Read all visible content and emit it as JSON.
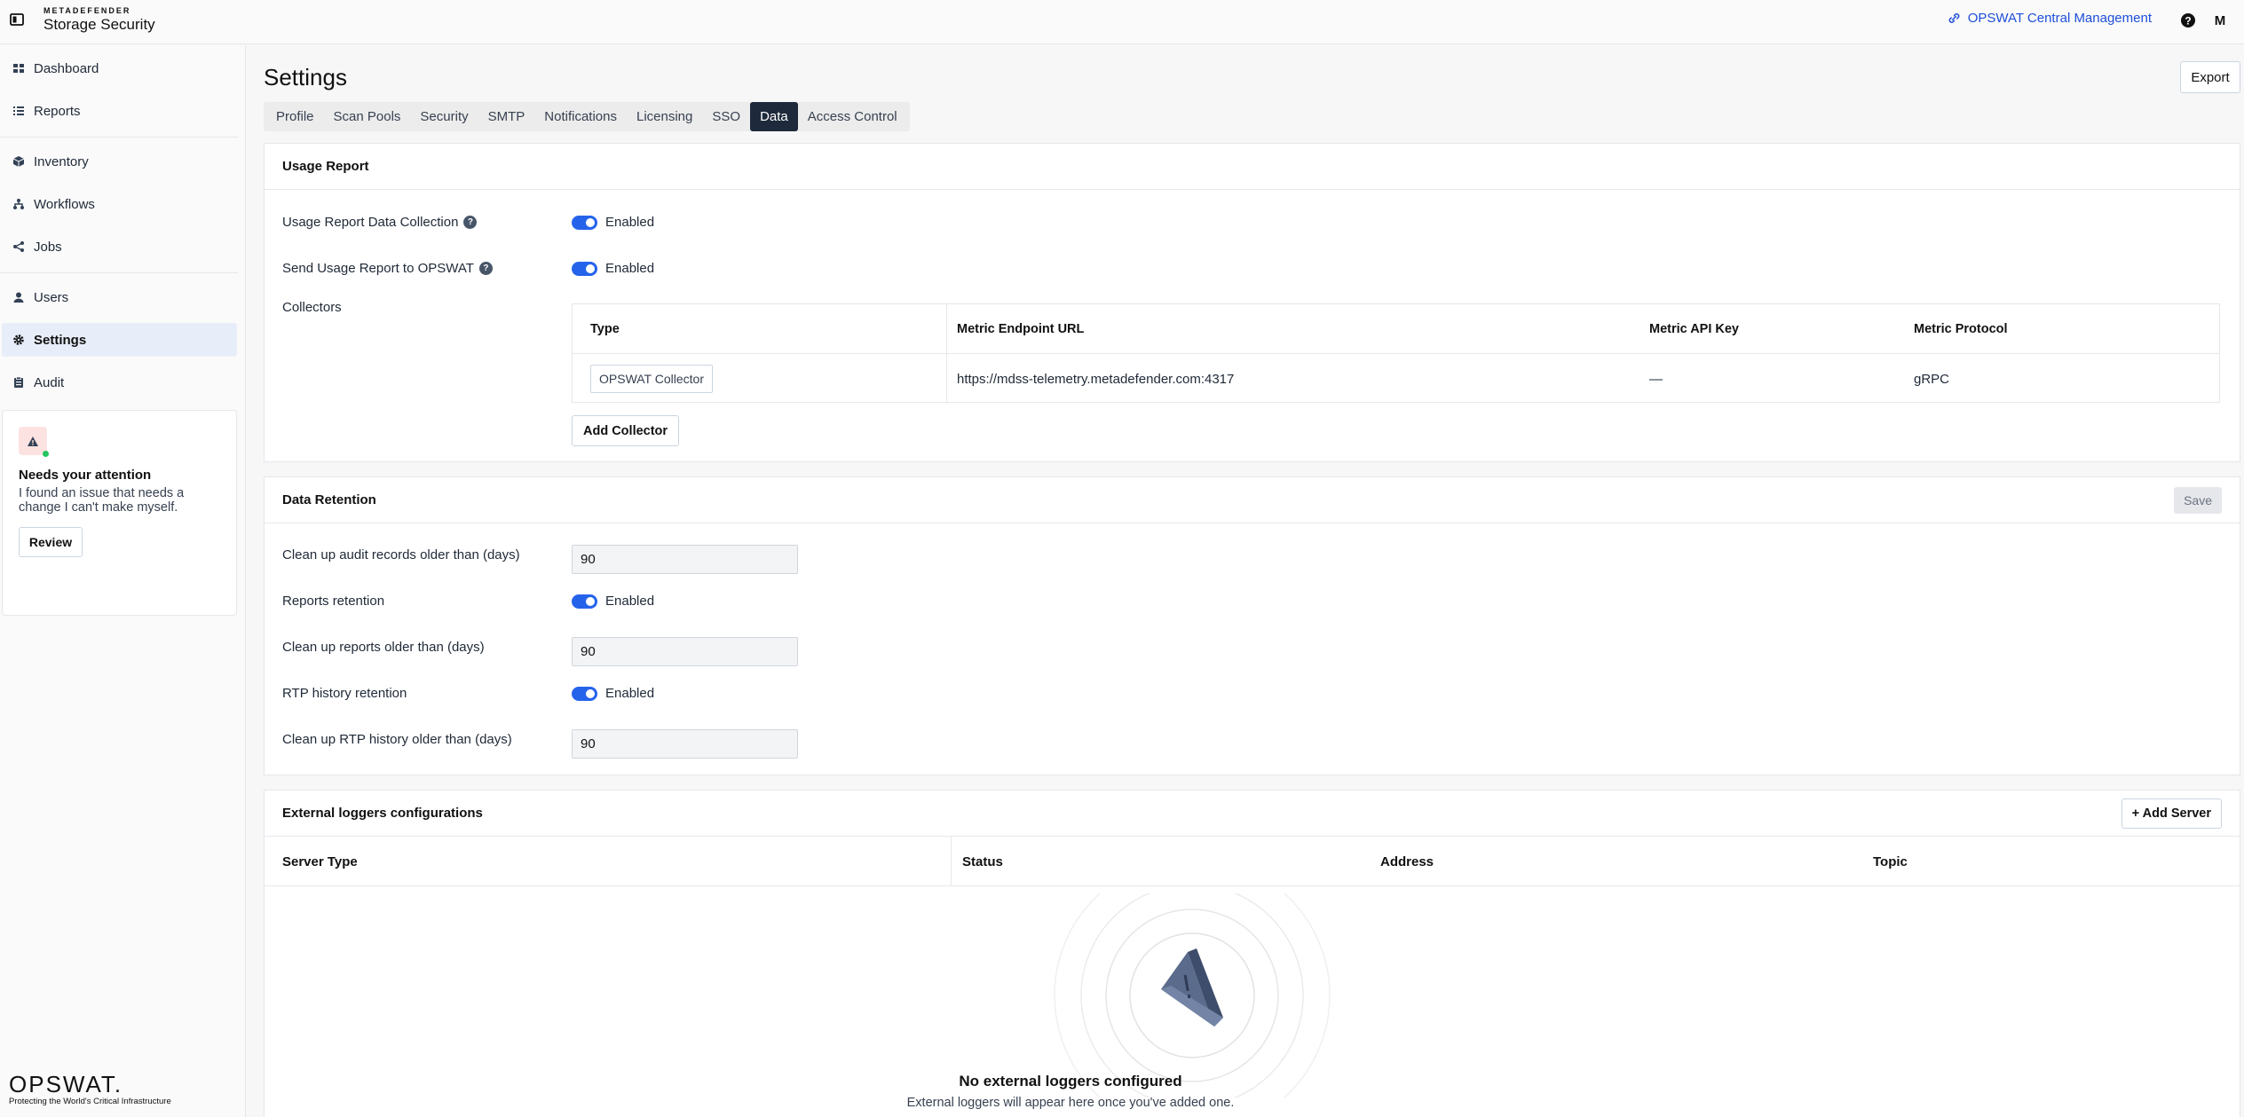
{
  "header": {
    "brand_top": "METADEFENDER",
    "brand_main": "Storage Security",
    "central_management": "OPSWAT Central Management",
    "avatar_initial": "M"
  },
  "sidebar": {
    "items": [
      {
        "label": "Dashboard",
        "icon": "dashboard-icon"
      },
      {
        "label": "Reports",
        "icon": "list-icon"
      },
      {
        "label": "Inventory",
        "icon": "cube-icon"
      },
      {
        "label": "Workflows",
        "icon": "workflow-icon"
      },
      {
        "label": "Jobs",
        "icon": "share-icon"
      },
      {
        "label": "Users",
        "icon": "user-icon"
      },
      {
        "label": "Settings",
        "icon": "gear-icon"
      },
      {
        "label": "Audit",
        "icon": "clipboard-icon"
      }
    ],
    "active": "Settings",
    "attention": {
      "title": "Needs your attention",
      "text": "I found an issue that needs a change I can't make myself.",
      "button": "Review"
    },
    "logo": {
      "word": "OPSWAT.",
      "tagline": "Protecting the World's Critical Infrastructure"
    }
  },
  "main": {
    "title": "Settings",
    "export_label": "Export",
    "tabs": [
      "Profile",
      "Scan Pools",
      "Security",
      "SMTP",
      "Notifications",
      "Licensing",
      "SSO",
      "Data",
      "Access Control"
    ],
    "active_tab": "Data"
  },
  "usage_report": {
    "title": "Usage Report",
    "data_collection_label": "Usage Report Data Collection",
    "data_collection_state": "Enabled",
    "send_report_label": "Send Usage Report to OPSWAT",
    "send_report_state": "Enabled",
    "collectors_label": "Collectors",
    "columns": [
      "Type",
      "Metric Endpoint URL",
      "Metric API Key",
      "Metric Protocol"
    ],
    "rows": [
      {
        "type": "OPSWAT Collector",
        "url": "https://mdss-telemetry.metadefender.com:4317",
        "api_key": "—",
        "protocol": "gRPC"
      }
    ],
    "add_collector_label": "Add Collector"
  },
  "data_retention": {
    "title": "Data Retention",
    "save_label": "Save",
    "audit_label": "Clean up audit records older than (days)",
    "audit_value": "90",
    "reports_retention_label": "Reports retention",
    "reports_retention_state": "Enabled",
    "reports_label": "Clean up reports older than (days)",
    "reports_value": "90",
    "rtp_retention_label": "RTP history retention",
    "rtp_retention_state": "Enabled",
    "rtp_label": "Clean up RTP history older than (days)",
    "rtp_value": "90"
  },
  "external_loggers": {
    "title": "External loggers configurations",
    "add_server_label": "+ Add Server",
    "columns": [
      "Server Type",
      "Status",
      "Address",
      "Topic"
    ],
    "empty_title": "No external loggers configured",
    "empty_subtitle": "External loggers will appear here once you've added one."
  },
  "colors": {
    "accent": "#2563eb",
    "active_tab": "#1e293b",
    "active_nav": "#e8eef9",
    "link": "#1d4ed8"
  }
}
